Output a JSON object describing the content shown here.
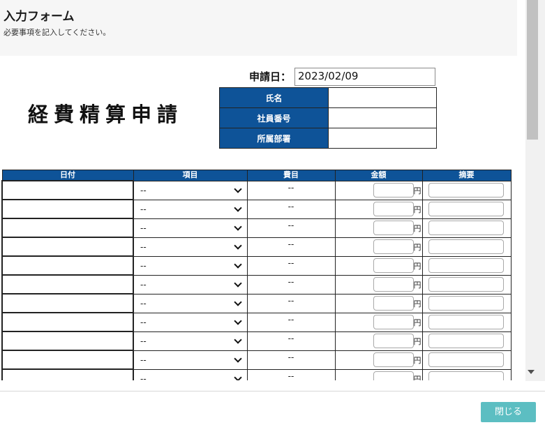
{
  "header": {
    "title": "入力フォーム",
    "description": "必要事項を記入してください。"
  },
  "document": {
    "title": "経費精算申請",
    "date_label": "申請日：",
    "date_value": "2023/02/09",
    "info_rows": [
      {
        "label": "氏名",
        "value": ""
      },
      {
        "label": "社員番号",
        "value": ""
      },
      {
        "label": "所属部署",
        "value": ""
      }
    ]
  },
  "expense_table": {
    "columns": [
      "日付",
      "項目",
      "費目",
      "金額",
      "摘要"
    ],
    "currency_unit": "円",
    "rows": [
      {
        "date": "",
        "item": "--",
        "account": "--",
        "amount": "",
        "memo": ""
      },
      {
        "date": "",
        "item": "--",
        "account": "--",
        "amount": "",
        "memo": ""
      },
      {
        "date": "",
        "item": "--",
        "account": "--",
        "amount": "",
        "memo": ""
      },
      {
        "date": "",
        "item": "--",
        "account": "--",
        "amount": "",
        "memo": ""
      },
      {
        "date": "",
        "item": "--",
        "account": "--",
        "amount": "",
        "memo": ""
      },
      {
        "date": "",
        "item": "--",
        "account": "--",
        "amount": "",
        "memo": ""
      },
      {
        "date": "",
        "item": "--",
        "account": "--",
        "amount": "",
        "memo": ""
      },
      {
        "date": "",
        "item": "--",
        "account": "--",
        "amount": "",
        "memo": ""
      },
      {
        "date": "",
        "item": "--",
        "account": "--",
        "amount": "",
        "memo": ""
      },
      {
        "date": "",
        "item": "--",
        "account": "--",
        "amount": "",
        "memo": ""
      },
      {
        "date": "",
        "item": "--",
        "account": "--",
        "amount": "",
        "memo": ""
      }
    ]
  },
  "footer": {
    "close_label": "閉じる"
  },
  "colors": {
    "header_blue": "#0e5398",
    "close_button": "#5cbec2"
  }
}
